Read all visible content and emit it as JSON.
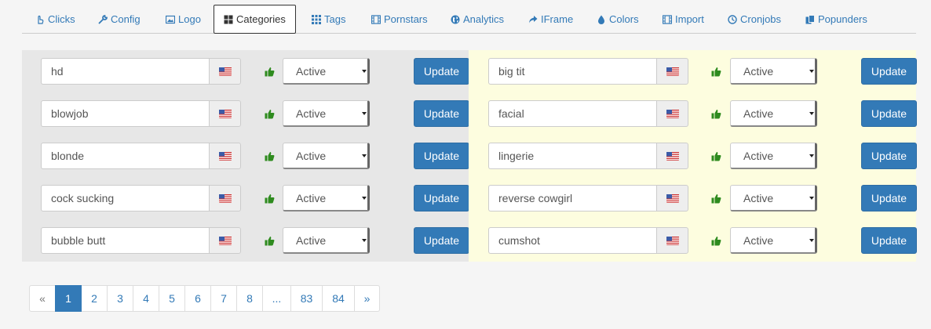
{
  "tabs": [
    {
      "label": "Clicks",
      "icon": "hand-pointer-icon"
    },
    {
      "label": "Config",
      "icon": "wrench-icon"
    },
    {
      "label": "Logo",
      "icon": "picture-icon"
    },
    {
      "label": "Categories",
      "icon": "th-large-icon",
      "active": true
    },
    {
      "label": "Tags",
      "icon": "th-icon"
    },
    {
      "label": "Pornstars",
      "icon": "film-icon"
    },
    {
      "label": "Analytics",
      "icon": "globe-icon"
    },
    {
      "label": "IFrame",
      "icon": "share-icon"
    },
    {
      "label": "Colors",
      "icon": "tint-icon"
    },
    {
      "label": "Import",
      "icon": "film-icon"
    },
    {
      "label": "Cronjobs",
      "icon": "clock-icon"
    },
    {
      "label": "Popunders",
      "icon": "duplicate-icon"
    }
  ],
  "categories_left": [
    {
      "name": "hd",
      "status": "Active",
      "update_label": "Update"
    },
    {
      "name": "blowjob",
      "status": "Active",
      "update_label": "Update"
    },
    {
      "name": "blonde",
      "status": "Active",
      "update_label": "Update"
    },
    {
      "name": "cock sucking",
      "status": "Active",
      "update_label": "Update"
    },
    {
      "name": "bubble butt",
      "status": "Active",
      "update_label": "Update"
    }
  ],
  "categories_right": [
    {
      "name": "big tit",
      "status": "Active",
      "update_label": "Update"
    },
    {
      "name": "facial",
      "status": "Active",
      "update_label": "Update"
    },
    {
      "name": "lingerie",
      "status": "Active",
      "update_label": "Update"
    },
    {
      "name": "reverse cowgirl",
      "status": "Active",
      "update_label": "Update"
    },
    {
      "name": "cumshot",
      "status": "Active",
      "update_label": "Update"
    }
  ],
  "row_icons": {
    "flag": "us-flag-icon",
    "status": "thumbs-up-icon"
  },
  "pagination": {
    "prev": "«",
    "pages": [
      "1",
      "2",
      "3",
      "4",
      "5",
      "6",
      "7",
      "8",
      "...",
      "83",
      "84"
    ],
    "current": "1",
    "next": "»"
  },
  "colors": {
    "primary": "#337ab7",
    "left_panel_bg": "#e7e7e7",
    "right_panel_bg": "#fdfddf",
    "thumb_green": "#2e8b1e"
  }
}
